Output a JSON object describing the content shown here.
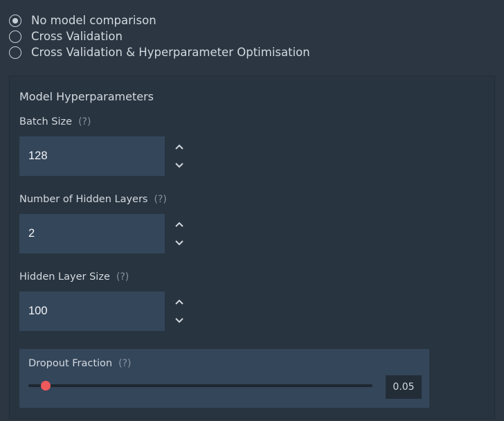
{
  "comparison": {
    "options": [
      {
        "label": "No model comparison",
        "selected": true
      },
      {
        "label": "Cross Validation",
        "selected": false
      },
      {
        "label": "Cross Validation & Hyperparameter Optimisation",
        "selected": false
      }
    ]
  },
  "hyperparameters": {
    "title": "Model Hyperparameters",
    "help_symbol": "(?)",
    "batch_size": {
      "label": "Batch Size",
      "value": "128"
    },
    "hidden_layers": {
      "label": "Number of Hidden Layers",
      "value": "2"
    },
    "hidden_layer_size": {
      "label": "Hidden Layer Size",
      "value": "100"
    },
    "dropout": {
      "label": "Dropout Fraction",
      "value": "0.05",
      "fraction": 0.05
    }
  },
  "colors": {
    "accent": "#f0595b",
    "input_bg": "#34465a",
    "page_bg": "#2b3642"
  }
}
